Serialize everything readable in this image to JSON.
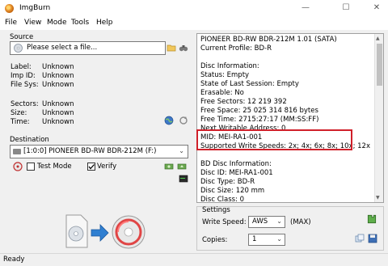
{
  "window": {
    "title": "ImgBurn"
  },
  "menu": [
    "File",
    "View",
    "Mode",
    "Tools",
    "Help"
  ],
  "source": {
    "group_label": "Source",
    "placeholder": "Please select a file...",
    "fields": [
      {
        "label": "Label:",
        "value": "Unknown"
      },
      {
        "label": "Imp ID:",
        "value": "Unknown"
      },
      {
        "label": "File Sys:",
        "value": "Unknown"
      },
      {
        "label": "Sectors:",
        "value": "Unknown"
      },
      {
        "label": "Size:",
        "value": "Unknown"
      },
      {
        "label": "Time:",
        "value": "Unknown"
      }
    ]
  },
  "destination": {
    "group_label": "Destination",
    "drive": "[1:0:0] PIONEER BD-RW   BDR-212M (F:)",
    "test_mode_label": "Test Mode",
    "test_mode_checked": false,
    "verify_label": "Verify",
    "verify_checked": true
  },
  "info": {
    "lines": [
      "PIONEER BD-RW   BDR-212M 1.01 (SATA)",
      "Current Profile: BD-R",
      "",
      "Disc Information:",
      "Status: Empty",
      "State of Last Session: Empty",
      "Erasable: No",
      "Free Sectors: 12 219 392",
      "Free Space: 25 025 314 816 bytes",
      "Free Time: 2715:27:17 (MM:SS:FF)",
      "Next Writable Address: 0",
      "MID: MEI-RA1-001",
      "Supported Write Speeds: 2x; 4x; 6x; 8x; 10x; 12x",
      "",
      "BD Disc Information:",
      "Disc ID: MEI-RA1-001",
      "Disc Type: BD-R",
      "Disc Size: 120 mm",
      "Disc Class: 0"
    ],
    "highlight_color": "#d0202a"
  },
  "settings": {
    "group_label": "Settings",
    "write_speed_label": "Write Speed:",
    "write_speed_value": "AWS",
    "max_label": "(MAX)",
    "copies_label": "Copies:",
    "copies_value": "1"
  },
  "status": {
    "text": "Ready"
  }
}
